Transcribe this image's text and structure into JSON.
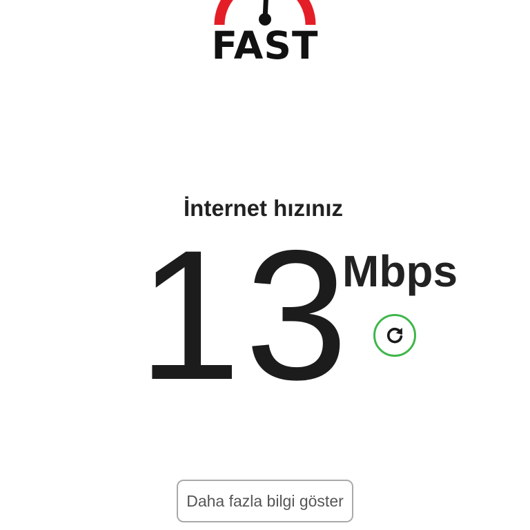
{
  "header": {
    "logo_text": "FAST",
    "logo_icon": "speedometer-icon",
    "colors": {
      "arc": "#e41e26",
      "needle": "#111111"
    }
  },
  "result": {
    "caption": "İnternet hızınız",
    "speed_value": "13",
    "speed_units": "Mbps"
  },
  "actions": {
    "refresh_icon": "refresh-icon",
    "refresh_color": "#3fb64a",
    "more_info_label": "Daha fazla bilgi göster"
  }
}
